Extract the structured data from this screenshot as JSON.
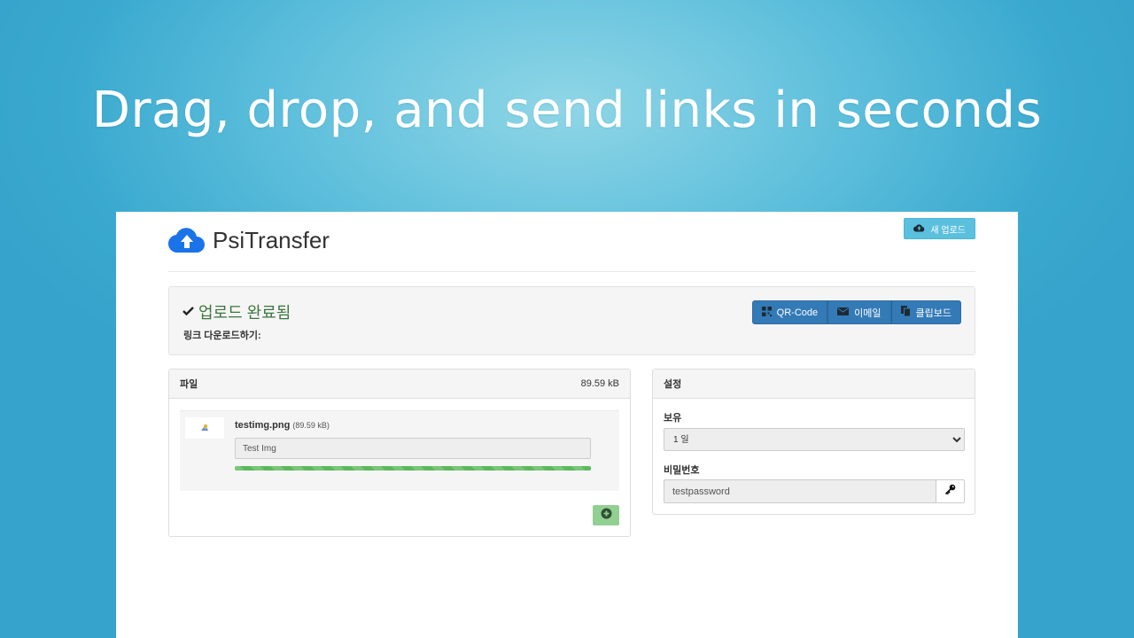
{
  "hero": {
    "title": "Drag, drop, and send links in seconds"
  },
  "brand": {
    "name": "PsiTransfer",
    "icon": "cloud-upload-icon",
    "color": "#1a73e8"
  },
  "header": {
    "new_upload_label": "새 업로드"
  },
  "upload_done": {
    "title": "업로드 완료됨",
    "download_label": "링크 다운로드하기:",
    "actions": {
      "qr_code": "QR-Code",
      "email": "이메일",
      "clipboard": "클립보드"
    }
  },
  "files": {
    "heading": "파일",
    "total_size": "89.59 kB",
    "items": [
      {
        "name": "testimg.png",
        "size": "(89.59 kB)",
        "comment": "Test Img",
        "progress_percent": 100
      }
    ]
  },
  "settings": {
    "heading": "설정",
    "retention_label": "보유",
    "retention_value": "1 일",
    "password_label": "비밀번호",
    "password_value": "testpassword"
  },
  "colors": {
    "primary": "#337ab7",
    "info": "#5bc0de",
    "success": "#5cb85c",
    "success_text": "#3c763d"
  }
}
